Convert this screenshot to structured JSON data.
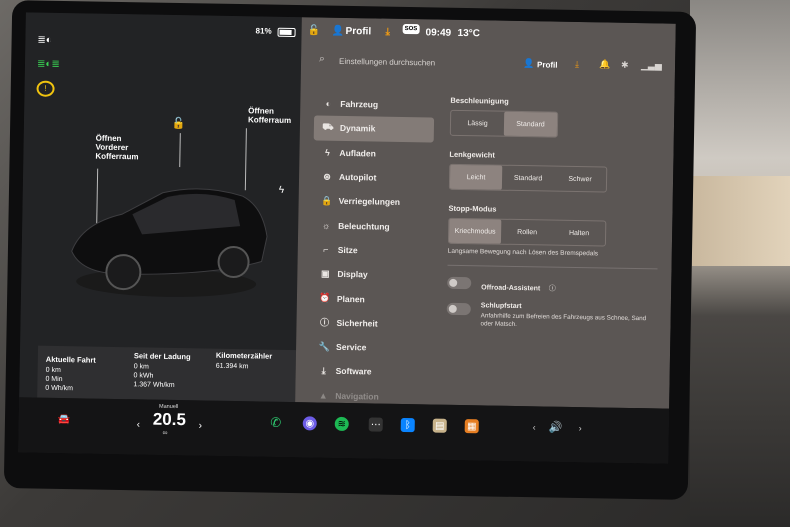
{
  "status": {
    "battery": "81%",
    "profile": "Profil",
    "time": "09:49",
    "temp": "13°C",
    "sos": "SOS"
  },
  "search": {
    "placeholder": "Einstellungen durchsuchen",
    "profile": "Profil"
  },
  "menu": [
    {
      "label": "Fahrzeug",
      "icon": "toggle-icon"
    },
    {
      "label": "Dynamik",
      "icon": "car-icon"
    },
    {
      "label": "Aufladen",
      "icon": "bolt-icon"
    },
    {
      "label": "Autopilot",
      "icon": "steering-wheel-icon"
    },
    {
      "label": "Verriegelungen",
      "icon": "lock-icon"
    },
    {
      "label": "Beleuchtung",
      "icon": "light-icon"
    },
    {
      "label": "Sitze",
      "icon": "seat-icon"
    },
    {
      "label": "Display",
      "icon": "display-icon"
    },
    {
      "label": "Planen",
      "icon": "alarm-icon"
    },
    {
      "label": "Sicherheit",
      "icon": "info-icon"
    },
    {
      "label": "Service",
      "icon": "wrench-icon"
    },
    {
      "label": "Software",
      "icon": "download-icon"
    },
    {
      "label": "Navigation",
      "icon": "navigation-icon"
    }
  ],
  "accel": {
    "label": "Beschleunigung",
    "options": [
      "Lässig",
      "Standard"
    ],
    "selected": 1
  },
  "steering": {
    "label": "Lenkgewicht",
    "options": [
      "Leicht",
      "Standard",
      "Schwer"
    ],
    "selected": 0
  },
  "stop": {
    "label": "Stopp-Modus",
    "options": [
      "Kriechmodus",
      "Rollen",
      "Halten"
    ],
    "selected": 0,
    "desc": "Langsame Bewegung nach Lösen des Bremspedals"
  },
  "offroad": {
    "label": "Offroad-Assistent"
  },
  "slip": {
    "label": "Schlupfstart",
    "desc": "Anfahrhilfe zum Befreien des Fahrzeugs aus Schnee, Sand oder Matsch."
  },
  "car": {
    "front_trunk": [
      "Öffnen",
      "Vorderer",
      "Kofferraum"
    ],
    "rear_trunk": [
      "Öffnen",
      "Kofferraum"
    ]
  },
  "trip": {
    "current_label": "Aktuelle Fahrt",
    "current": [
      "0 km",
      "0 Min",
      "0 Wh/km"
    ],
    "since_label": "Seit der Ladung",
    "since": [
      "0 km",
      "0 kWh",
      "1.367 Wh/km"
    ],
    "odo_label": "Kilometerzähler",
    "odo": "61.394 km"
  },
  "dock": {
    "temp_mode": "Manuell",
    "temperature": "20.5"
  }
}
